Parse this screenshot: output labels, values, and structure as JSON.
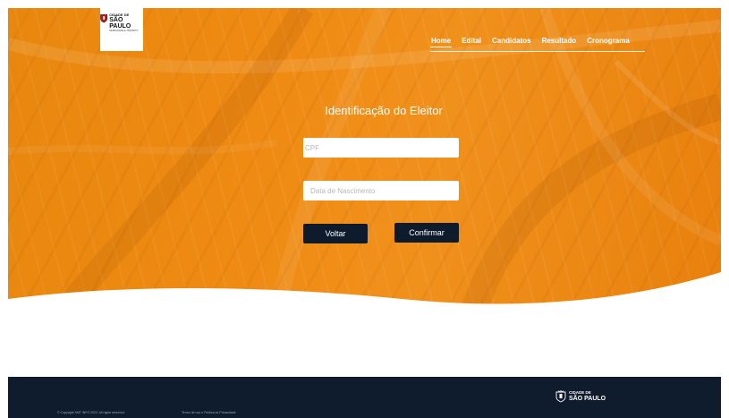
{
  "brand": {
    "logo_line1": "CIDADE DE",
    "logo_line2": "SÃO PAULO",
    "logo_line3": "MOBILIDADE E TRÂNSITO"
  },
  "nav": {
    "items": [
      {
        "label": "Home",
        "active": true
      },
      {
        "label": "Edital",
        "active": false
      },
      {
        "label": "Candidatos",
        "active": false
      },
      {
        "label": "Resultado",
        "active": false
      },
      {
        "label": "Cronograma",
        "active": false
      }
    ]
  },
  "form": {
    "title": "Identificação do Eleitor",
    "cpf_placeholder": "CPF",
    "cpf_value": "",
    "birth_placeholder": "Data de Nascimento",
    "birth_value": "",
    "back_label": "Voltar",
    "confirm_label": "Confirmar"
  },
  "footer": {
    "copyright": "© Copyright SMT INFO 2022. All rights reserved.",
    "terms": "Termo de uso e Política de Privacidade",
    "logo_line1": "CIDADE DE",
    "logo_line2": "SÃO PAULO"
  },
  "colors": {
    "hero_orange": "#ef8a12",
    "dark_navy": "#0e1b2d",
    "white": "#ffffff"
  },
  "icons": {
    "header_logo": "city-coat-of-arms-icon",
    "footer_logo": "city-coat-of-arms-icon"
  }
}
